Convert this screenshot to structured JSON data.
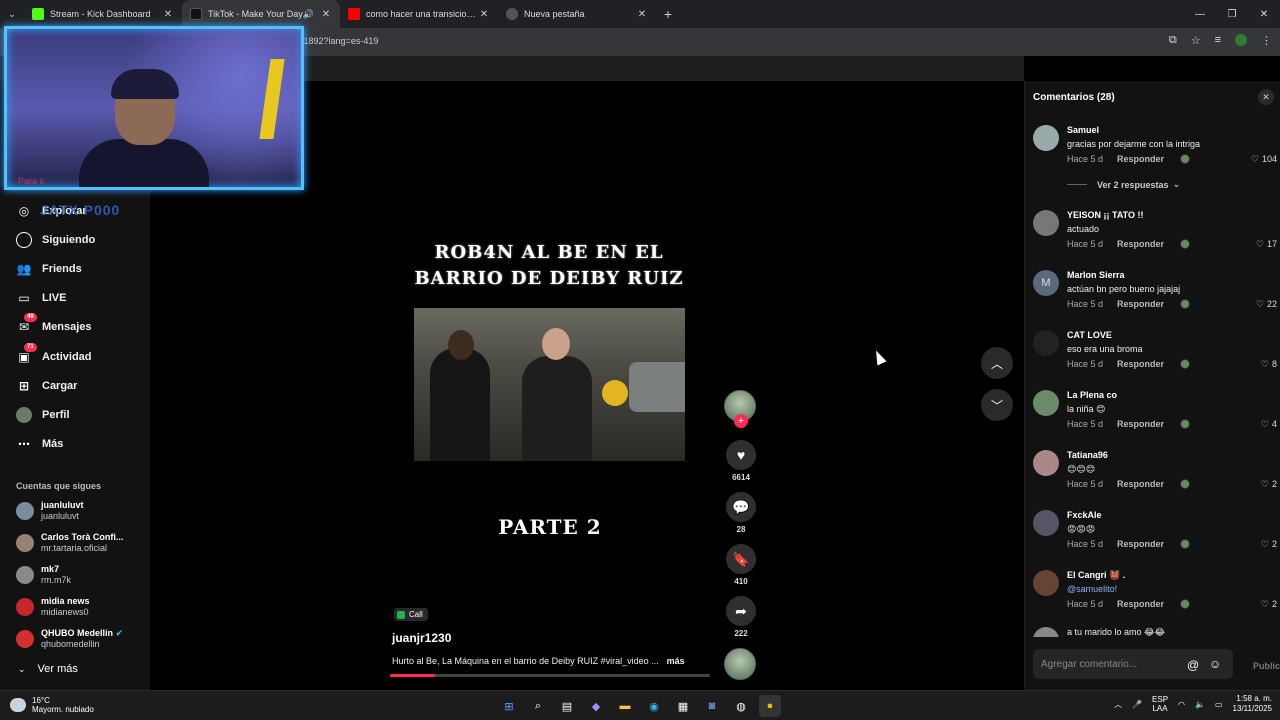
{
  "browser": {
    "tabs": [
      {
        "title": "Stream - Kick Dashboard",
        "color": "#53fc18",
        "active": false
      },
      {
        "title": "TikTok - Make Your Day",
        "color": "#111111",
        "active": true
      },
      {
        "title": "como hacer una transicion - Yo",
        "color": "#ff0000",
        "active": false
      },
      {
        "title": "Nueva pestaña",
        "color": "#555555",
        "active": false
      }
    ],
    "url": "464 1892?lang=es-419"
  },
  "sidebar": {
    "nav": [
      {
        "label": "Explorar",
        "icon": "compass-icon",
        "badge": ""
      },
      {
        "label": "Siguiendo",
        "icon": "following-icon",
        "badge": ""
      },
      {
        "label": "Friends",
        "icon": "friends-icon",
        "badge": ""
      },
      {
        "label": "LIVE",
        "icon": "live-icon",
        "badge": ""
      },
      {
        "label": "Mensajes",
        "icon": "messages-icon",
        "badge": "49"
      },
      {
        "label": "Actividad",
        "icon": "activity-icon",
        "badge": "71"
      },
      {
        "label": "Cargar",
        "icon": "upload-icon",
        "badge": ""
      },
      {
        "label": "Perfil",
        "icon": "profile-icon",
        "badge": ""
      },
      {
        "label": "Más",
        "icon": "more-icon",
        "badge": ""
      }
    ],
    "following_title": "Cuentas que sigues",
    "following": [
      {
        "name": "juanluluvt",
        "user": "juanluluvt",
        "color": "#7a8aa0"
      },
      {
        "name": "Carlos Torà Confi...",
        "user": "mr.tartaria.oficial",
        "color": "#9a8070"
      },
      {
        "name": "mk7",
        "user": "rm.m7k",
        "color": "#8a8a8a"
      },
      {
        "name": "midia news",
        "user": "midianews0",
        "color": "#c62828"
      },
      {
        "name": "QHUBO Medellín",
        "user": "qhubomedellin",
        "color": "#d32f2f"
      }
    ],
    "see_more": "Ver más"
  },
  "overlay_text": "Para ti",
  "watermark": "JATX P000",
  "video": {
    "title_line1": "ROB4N AL BE EN EL",
    "title_line2": "BARRIO DE DEIBY RUIZ",
    "part": "PARTE 2",
    "call_label": "Call",
    "author": "juanjr1230",
    "description": "Hurto al Be, La Máquina en el barrio de Deiby RUIZ #viral_video ...",
    "more": "más",
    "progress": 0.14
  },
  "actions": {
    "likes": "6614",
    "comments": "28",
    "saves": "410",
    "shares": "222"
  },
  "comments_panel": {
    "title": "Comentarios (28)",
    "view_replies": "Ver 2 respuestas",
    "reply_label": "Responder",
    "placeholder": "Agregar comentario...",
    "post": "Publicar",
    "items": [
      {
        "author": "Samuel",
        "text": "gracias por dejarme con la intriga",
        "time": "Hace 5 d",
        "likes": "104",
        "color": "#9aa"
      },
      {
        "author": "YEISON ¡¡ TATO !!",
        "text": "actuado",
        "time": "Hace 5 d",
        "likes": "17",
        "color": "#777"
      },
      {
        "author": "Marlon Sierra",
        "text": "actúan bn pero bueno jajajaj",
        "time": "Hace 5 d",
        "likes": "22",
        "color": "#5a6a7a",
        "initial": "M"
      },
      {
        "author": "CAT LOVE",
        "text": "eso era una broma",
        "time": "Hace 5 d",
        "likes": "8",
        "color": "#222"
      },
      {
        "author": "La Plena co",
        "text": "la niña 😊",
        "time": "Hace 5 d",
        "likes": "4",
        "color": "#6a8a6a"
      },
      {
        "author": "Tatiana96",
        "text": "😊😊😊",
        "time": "Hace 5 d",
        "likes": "2",
        "color": "#a88"
      },
      {
        "author": "FxckAle",
        "text": "😡😡😡",
        "time": "Hace 5 d",
        "likes": "2",
        "color": "#556"
      },
      {
        "author": "El Cangri 👹 .",
        "text": "@samuelito!",
        "time": "Hace 5 d",
        "likes": "2",
        "color": "#643"
      },
      {
        "author": "",
        "text": "a tu marido lo amo 😂😂",
        "time": "",
        "likes": "",
        "color": "#888"
      }
    ]
  },
  "taskbar": {
    "temp": "16°C",
    "weather": "Mayorm. nublado",
    "lang1": "ESP",
    "lang2": "LAA",
    "time": "1:58 a. m.",
    "date": "13/11/2025"
  }
}
